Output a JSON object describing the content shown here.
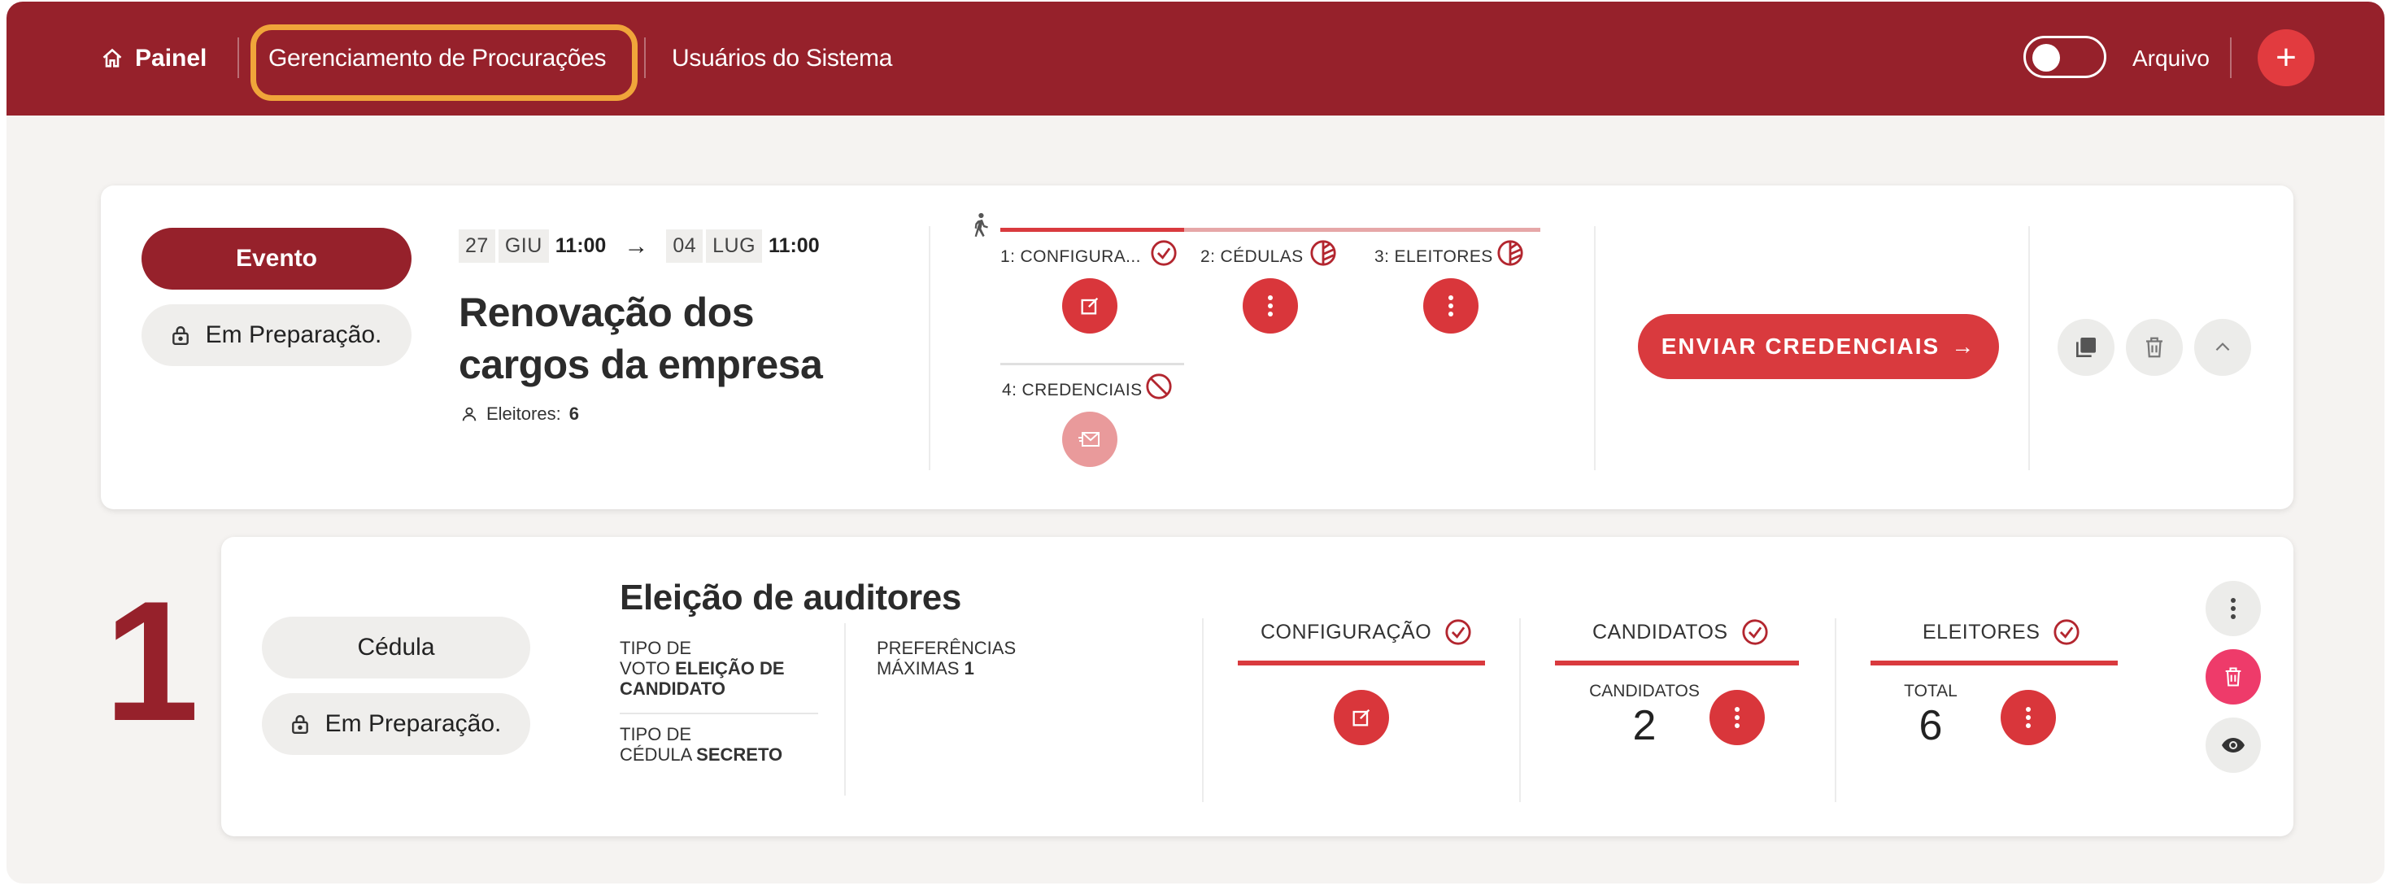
{
  "nav": {
    "home_label": "Painel",
    "proxy_label": "Gerenciamento de Procurações",
    "users_label": "Usuários do Sistema",
    "archive_label": "Arquivo",
    "add_label": "+"
  },
  "event": {
    "type_label": "Evento",
    "status_label": "Em Preparação.",
    "start_day": "27",
    "start_month": "GIU",
    "start_time": "11:00",
    "arrow": "→",
    "end_day": "04",
    "end_month": "LUG",
    "end_time": "11:00",
    "title_line1": "Renovação dos",
    "title_line2": "cargos da empresa",
    "voters_label": "Eleitores:",
    "voters_count": "6",
    "steps": [
      {
        "label": "1: CONFIGURA..."
      },
      {
        "label": "2: CÉDULAS"
      },
      {
        "label": "3: ELEITORES"
      },
      {
        "label": "4: CREDENCIAIS"
      }
    ],
    "send_label": "ENVIAR CREDENCIAIS",
    "send_arrow": "→"
  },
  "ballot": {
    "number": "1",
    "type_label": "Cédula",
    "status_label": "Em Preparação.",
    "title": "Eleição de auditores",
    "vote_type_label_1": "TIPO DE",
    "vote_type_label_2": "VOTO",
    "vote_type_value_1": "ELEIÇÃO DE",
    "vote_type_value_2": "CANDIDATO",
    "ballot_type_label_1": "TIPO DE",
    "ballot_type_label_2": "CÉDULA",
    "ballot_type_value": "SECRETO",
    "pref_label_1": "PREFERÊNCIAS",
    "pref_label_2": "MÁXIMAS",
    "pref_value": "1",
    "config_label": "CONFIGURAÇÃO",
    "candidates_label": "CANDIDATOS",
    "candidates_count_label": "CANDIDATOS",
    "candidates_count": "2",
    "voters_label": "ELEITORES",
    "voters_total_label": "TOTAL",
    "voters_total": "6"
  },
  "colors": {
    "brand": "#96212b",
    "accent": "#d93a3e",
    "highlight": "#f0a53a"
  }
}
